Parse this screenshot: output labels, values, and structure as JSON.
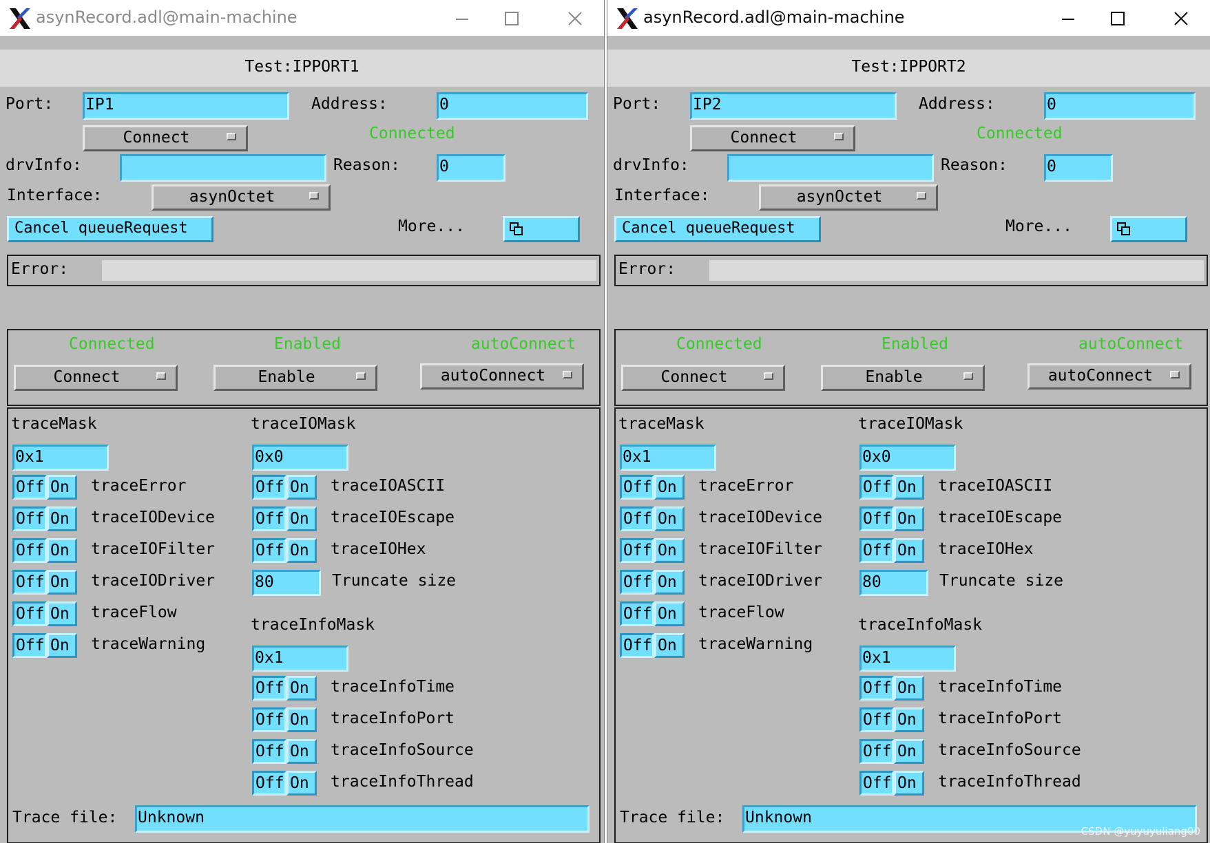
{
  "windows": [
    {
      "title": "asynRecord.adl@main-machine",
      "record_name": "Test:IPPORT1",
      "port_label": "Port:",
      "port_value": "IP1",
      "address_label": "Address:",
      "address_value": "0",
      "connect_menu": "Connect",
      "connect_status": "Connected",
      "drvinfo_label": "drvInfo:",
      "drvinfo_value": "",
      "reason_label": "Reason:",
      "reason_value": "0",
      "interface_label": "Interface:",
      "interface_menu": "asynOctet",
      "cancel_button": "Cancel queueRequest",
      "more_label": "More...",
      "error_label": "Error:",
      "error_value": "",
      "status": {
        "connected": "Connected",
        "enabled": "Enabled",
        "autoconnect": "autoConnect",
        "connect_menu": "Connect",
        "enable_menu": "Enable",
        "autoconnect_menu": "autoConnect"
      },
      "trace_mask_label": "traceMask",
      "trace_mask_value": "0x1",
      "trace_io_mask_label": "traceIOMask",
      "trace_io_mask_value": "0x0",
      "trace_info_mask_label": "traceInfoMask",
      "trace_info_mask_value": "0x1",
      "truncate_value": "80",
      "truncate_label": "Truncate size",
      "trace_file_label": "Trace file:",
      "trace_file_value": "Unknown",
      "trace_items": [
        "traceError",
        "traceIODevice",
        "traceIOFilter",
        "traceIODriver",
        "traceFlow",
        "traceWarning"
      ],
      "trace_io_items": [
        "traceIOASCII",
        "traceIOEscape",
        "traceIOHex"
      ],
      "trace_info_items": [
        "traceInfoTime",
        "traceInfoPort",
        "traceInfoSource",
        "traceInfoThread"
      ],
      "off_label": "Off",
      "on_label": "On"
    },
    {
      "title": "asynRecord.adl@main-machine",
      "record_name": "Test:IPPORT2",
      "port_label": "Port:",
      "port_value": "IP2",
      "address_label": "Address:",
      "address_value": "0",
      "connect_menu": "Connect",
      "connect_status": "Connected",
      "drvinfo_label": "drvInfo:",
      "drvinfo_value": "",
      "reason_label": "Reason:",
      "reason_value": "0",
      "interface_label": "Interface:",
      "interface_menu": "asynOctet",
      "cancel_button": "Cancel queueRequest",
      "more_label": "More...",
      "error_label": "Error:",
      "error_value": "",
      "status": {
        "connected": "Connected",
        "enabled": "Enabled",
        "autoconnect": "autoConnect",
        "connect_menu": "Connect",
        "enable_menu": "Enable",
        "autoconnect_menu": "autoConnect"
      },
      "trace_mask_label": "traceMask",
      "trace_mask_value": "0x1",
      "trace_io_mask_label": "traceIOMask",
      "trace_io_mask_value": "0x0",
      "trace_info_mask_label": "traceInfoMask",
      "trace_info_mask_value": "0x1",
      "truncate_value": "80",
      "truncate_label": "Truncate size",
      "trace_file_label": "Trace file:",
      "trace_file_value": "Unknown",
      "trace_items": [
        "traceError",
        "traceIODevice",
        "traceIOFilter",
        "traceIODriver",
        "traceFlow",
        "traceWarning"
      ],
      "trace_io_items": [
        "traceIOASCII",
        "traceIOEscape",
        "traceIOHex"
      ],
      "trace_info_items": [
        "traceInfoTime",
        "traceInfoPort",
        "traceInfoSource",
        "traceInfoThread"
      ],
      "off_label": "Off",
      "on_label": "On"
    }
  ],
  "watermark": "CSDN @yuyuyuliang00",
  "colors": {
    "panel": "#bbbbbb",
    "field": "#73dfff",
    "status_green": "#33cc22"
  }
}
